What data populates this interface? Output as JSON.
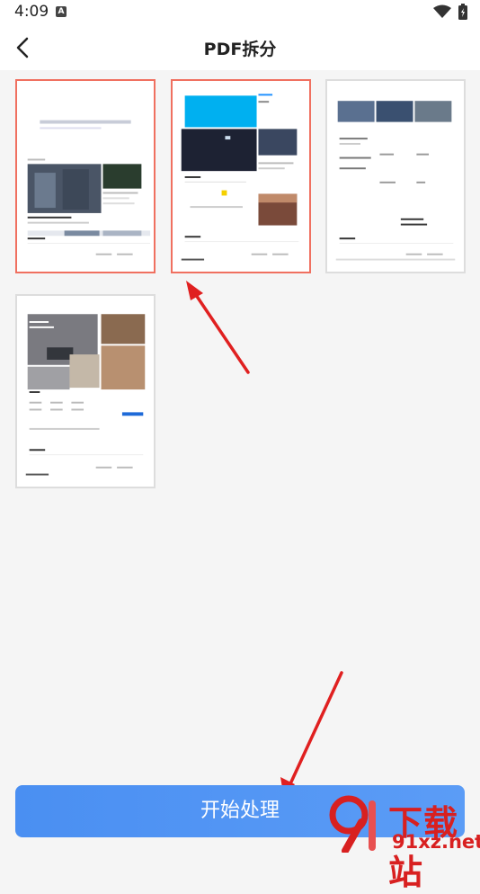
{
  "status_bar": {
    "time": "4:09",
    "notification_letter": "A",
    "icons": [
      "wifi-icon",
      "battery-icon"
    ]
  },
  "header": {
    "title": "PDF拆分",
    "back_icon": "chevron-left-icon"
  },
  "pages": [
    {
      "id": "page-1",
      "selected": true
    },
    {
      "id": "page-2",
      "selected": true
    },
    {
      "id": "page-3",
      "selected": false
    },
    {
      "id": "page-4",
      "selected": false
    }
  ],
  "bottom": {
    "start_label": "开始处理"
  },
  "watermark": {
    "text": "下载站",
    "url": "91xz.net"
  },
  "colors": {
    "accent": "#4a8ff2",
    "selection_border": "#f07060",
    "annotation_arrow": "#e02020"
  }
}
